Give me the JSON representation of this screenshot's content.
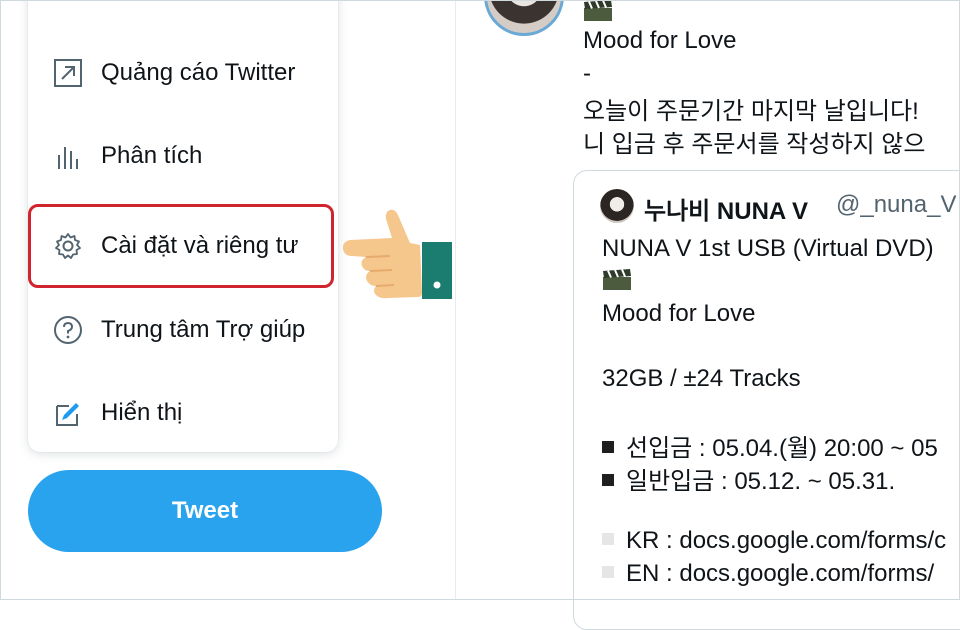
{
  "menu": {
    "items": [
      {
        "label": "Quảng cáo Twitter",
        "icon": "external-arrow-icon"
      },
      {
        "label": "Phân tích",
        "icon": "bar-chart-icon"
      },
      {
        "label": "Cài đặt và riêng tư",
        "icon": "gear-icon"
      },
      {
        "label": "Trung tâm Trợ giúp",
        "icon": "help-circle-icon"
      },
      {
        "label": "Hiển thị",
        "icon": "brush-display-icon"
      }
    ]
  },
  "tweet_button": {
    "label": "Tweet"
  },
  "tweet": {
    "line1": "Mood for Love",
    "line2": "-",
    "line3": "오늘이 주문기간 마지막 날입니다!",
    "line4": "니 입금 후 주문서를 작성하지 않으"
  },
  "quoted": {
    "name": "누나비 NUNA V",
    "handle": "@_nuna_V ·",
    "lines": [
      "NUNA V 1st USB (Virtual DVD)",
      "Mood for Love",
      "32GB / ±24 Tracks",
      "선입금 : 05.04.(월) 20:00 ~ 05",
      "일반입금 : 05.12. ~ 05.31.",
      "KR : docs.google.com/forms/c",
      "EN : docs.google.com/forms/"
    ]
  },
  "colors": {
    "accent": "#2aa3ef",
    "highlight": "#d0252e",
    "text": "#0f1419",
    "muted": "#536471"
  }
}
